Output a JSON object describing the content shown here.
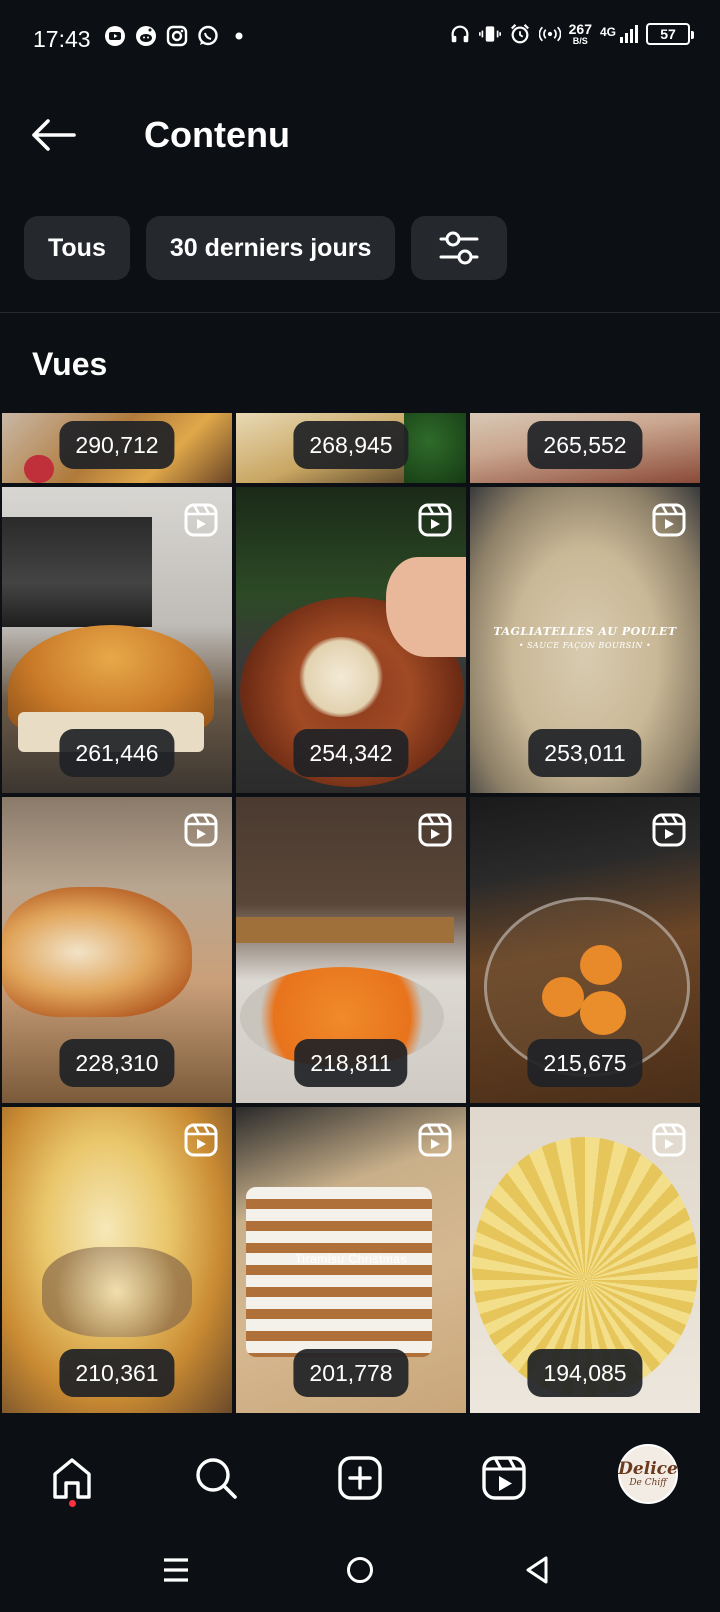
{
  "status_bar": {
    "time": "17:43",
    "left_icons": [
      "youtube-icon",
      "reddit-icon",
      "instagram-icon",
      "whatsapp-icon",
      "dot-icon"
    ],
    "right_icons": [
      "headphones-icon",
      "vibrate-icon",
      "alarm-icon",
      "hotspot-icon"
    ],
    "net_speed_value": "267",
    "net_speed_unit": "B/S",
    "network": "4G",
    "battery": "57"
  },
  "header": {
    "title": "Contenu",
    "back_icon": "arrow-left-icon"
  },
  "filters": {
    "all_label": "Tous",
    "period_label": "30 derniers jours",
    "settings_icon": "sliders-icon"
  },
  "section": {
    "title": "Vues"
  },
  "grid": {
    "items": [
      {
        "views": "290,712",
        "reel": false
      },
      {
        "views": "268,945",
        "reel": false
      },
      {
        "views": "265,552",
        "reel": false
      },
      {
        "views": "261,446",
        "reel": true
      },
      {
        "views": "254,342",
        "reel": true
      },
      {
        "views": "253,011",
        "reel": true,
        "overlay_title": "TAGLIATELLES AU POULET",
        "overlay_sub": "• SAUCE FAÇON BOURSIN •"
      },
      {
        "views": "228,310",
        "reel": true
      },
      {
        "views": "218,811",
        "reel": true
      },
      {
        "views": "215,675",
        "reel": true
      },
      {
        "views": "210,361",
        "reel": true
      },
      {
        "views": "201,778",
        "reel": true,
        "overlay_title": "Tiramisu Christmas"
      },
      {
        "views": "194,085",
        "reel": true
      }
    ]
  },
  "bottom_nav": {
    "items": [
      "home-icon",
      "search-icon",
      "create-icon",
      "reels-icon"
    ],
    "avatar_line1": "Delice",
    "avatar_line2": "De Chiff"
  },
  "system_nav": [
    "recents-icon",
    "home-circle-icon",
    "back-triangle-icon"
  ],
  "colors": {
    "background": "#0c1014",
    "chip": "#25292e",
    "notification": "#ff3040"
  }
}
